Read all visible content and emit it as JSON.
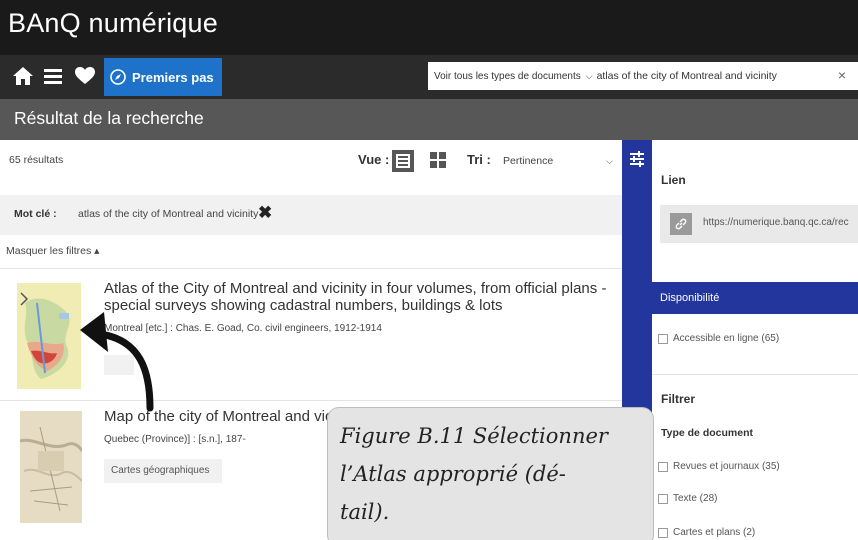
{
  "app": {
    "title": "BAnQ numérique"
  },
  "nav": {
    "icons": [
      "home-icon",
      "menu-icon",
      "heart-icon"
    ],
    "premiers_pas": "Premiers pas"
  },
  "search": {
    "type": "Voir tous les types de documents",
    "query": "atlas of the city of Montreal and vicinity",
    "clear": "×"
  },
  "results_header": {
    "title": "Résultat de la recherche"
  },
  "toolbar": {
    "count": "65 résultats",
    "vue_label": "Vue :",
    "tri_label": "Tri :",
    "sort_value": "Pertinence"
  },
  "filters": {
    "keyword_label": "Mot clé :",
    "keyword_value": "atlas of the city of Montreal and vicinity",
    "remove": "✖",
    "hide_filters": "Masquer les filtres ▴"
  },
  "results": [
    {
      "title_line1": "Atlas of the City of Montreal and vicinity in four volumes, from official plans -",
      "title_line2": "special surveys showing cadastral numbers, buildings & lots",
      "meta": "Montreal [etc.] : Chas. E. Goad, Co. civil engineers, 1912-1914"
    },
    {
      "title": "Map of the city of Montreal and vicin",
      "meta": "Quebec (Province)] : [s.n.], 187-",
      "badge": "Cartes géographiques"
    }
  ],
  "sidebar": {
    "lien_heading": "Lien",
    "lien_url": "https://numerique.banq.qc.ca/rec",
    "disponibilite": "Disponibilité",
    "accessible": "Accessible en ligne (65)",
    "filtrer": "Filtrer",
    "type_document": "Type de document",
    "types": [
      "Revues et journaux (35)",
      "Texte (28)",
      "Cartes et plans (2)"
    ]
  },
  "caption": {
    "line1": "Figure B.11 Sélectionner",
    "line2": "l’Atlas approprié (dé-",
    "line3": "tail)."
  },
  "colors": {
    "topbar": "#1a1a1a",
    "navbar": "#2b2b2b",
    "accent_blue": "#1e72c9",
    "sidebar_blue": "#22369e",
    "result_bar": "#575757"
  }
}
